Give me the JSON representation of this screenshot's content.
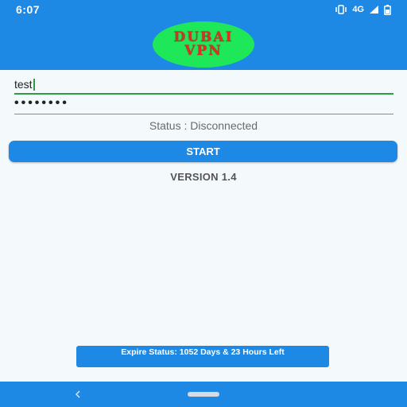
{
  "status_bar": {
    "time": "6:07",
    "network_label": "4G",
    "icons": [
      "vibrate-icon",
      "signal-icon",
      "battery-icon"
    ]
  },
  "app_bar": {
    "logo_line1": "DUBAI",
    "logo_line2": "VPN"
  },
  "form": {
    "username_value": "test",
    "password_dots": "••••••••",
    "status_text": "Status : Disconnected",
    "start_label": "START",
    "version_text": "VERSION 1.4"
  },
  "footer": {
    "expire_text": "Expire Status: 1052 Days & 23 Hours Left"
  },
  "nav": {
    "back_glyph": "<"
  },
  "colors": {
    "primary": "#1e88e5",
    "logo_bg": "#1ee85a",
    "logo_text": "#d93025",
    "focus_underline": "#2e9b47",
    "background": "#f4f9fc"
  }
}
